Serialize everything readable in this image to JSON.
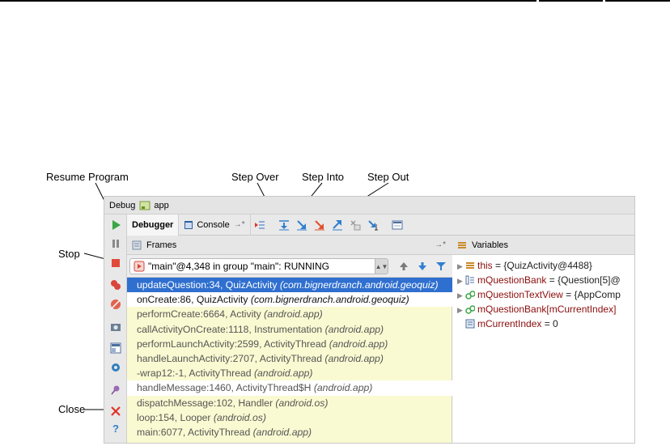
{
  "callouts": {
    "resume": "Resume Program",
    "step_over": "Step Over",
    "step_into": "Step Into",
    "step_out": "Step Out",
    "stop": "Stop",
    "close": "Close"
  },
  "window": {
    "title": "Debug",
    "config": "app"
  },
  "tabs": {
    "debugger": "Debugger",
    "console": "Console"
  },
  "frames": {
    "header": "Frames",
    "thread": "\"main\"@4,348 in group \"main\": RUNNING",
    "rows": [
      {
        "method": "updateQuestion:34, QuizActivity",
        "pkg": "(com.bignerdranch.android.geoquiz)",
        "state": "selected"
      },
      {
        "method": "onCreate:86, QuizActivity",
        "pkg": "(com.bignerdranch.android.geoquiz)",
        "state": "plain"
      },
      {
        "method": "performCreate:6664, Activity",
        "pkg": "(android.app)",
        "state": "lib"
      },
      {
        "method": "callActivityOnCreate:1118, Instrumentation",
        "pkg": "(android.app)",
        "state": "lib"
      },
      {
        "method": "performLaunchActivity:2599, ActivityThread",
        "pkg": "(android.app)",
        "state": "lib"
      },
      {
        "method": "handleLaunchActivity:2707, ActivityThread",
        "pkg": "(android.app)",
        "state": "lib"
      },
      {
        "method": "-wrap12:-1, ActivityThread",
        "pkg": "(android.app)",
        "state": "lib"
      },
      {
        "method": "handleMessage:1460, ActivityThread$H",
        "pkg": "(android.app)",
        "state": "white"
      },
      {
        "method": "dispatchMessage:102, Handler",
        "pkg": "(android.os)",
        "state": "lib"
      },
      {
        "method": "loop:154, Looper",
        "pkg": "(android.os)",
        "state": "lib"
      },
      {
        "method": "main:6077, ActivityThread",
        "pkg": "(android.app)",
        "state": "lib"
      }
    ]
  },
  "variables": {
    "header": "Variables",
    "rows": [
      {
        "name": "this",
        "value": " = {QuizActivity@4488}",
        "icon": "field-icon"
      },
      {
        "name": "mQuestionBank",
        "value": " = {Question[5]@",
        "icon": "array-icon"
      },
      {
        "name": "mQuestionTextView",
        "value": " = {AppComp",
        "icon": "watch-icon"
      },
      {
        "name": "mQuestionBank[mCurrentIndex]",
        "value": "",
        "icon": "watch-icon"
      },
      {
        "name": "mCurrentIndex",
        "value": " = 0",
        "icon": "primitive-icon"
      }
    ]
  },
  "colors": {
    "selection": "#2f6fcf",
    "library_frame_bg": "#fafad2",
    "var_name": "#8b0b0b"
  }
}
